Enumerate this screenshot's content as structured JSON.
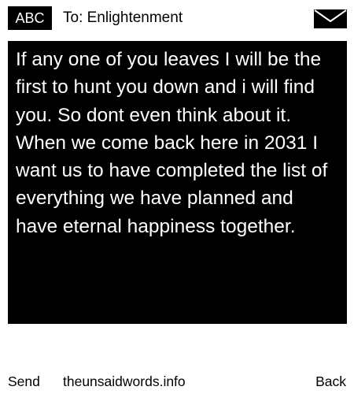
{
  "header": {
    "mode_label": "ABC",
    "recipient": "To: Enlightenment",
    "envelope_icon": "envelope-icon"
  },
  "message": {
    "body": "If any one of you leaves I will be the first to hunt you down and i will find you. So dont even think about it. When we come back here in 2031 I want us to have completed the list of everything we have planned and have eternal happiness together."
  },
  "footer": {
    "send_label": "Send",
    "site_label": "theunsaidwords.info",
    "back_label": "Back"
  },
  "colors": {
    "background": "#ffffff",
    "panel": "#000000",
    "panel_text": "#ffffff",
    "text": "#000000"
  }
}
